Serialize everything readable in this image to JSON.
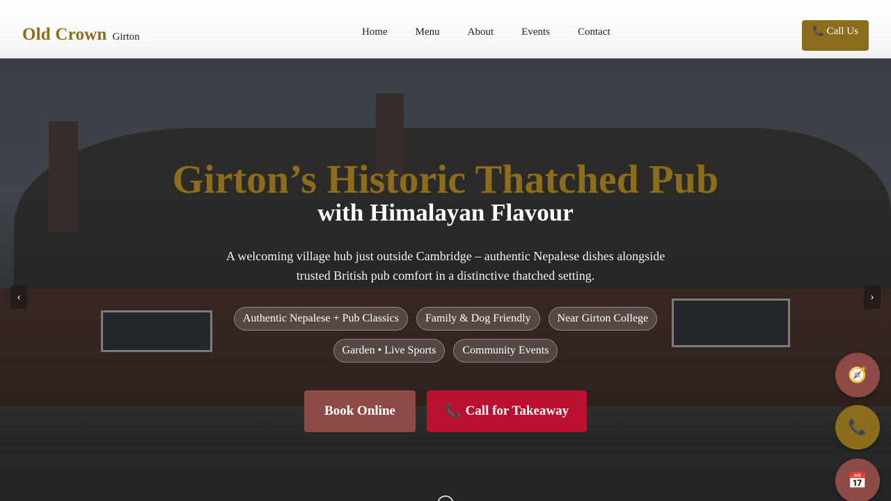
{
  "header": {
    "brand_name": "Old Crown",
    "brand_sub": "Girton",
    "nav": [
      "Home",
      "Menu",
      "About",
      "Events",
      "Contact"
    ],
    "call_label": "Call Us",
    "call_icon": "phone-icon"
  },
  "hero": {
    "title": "Girton’s Historic Thatched Pub",
    "subtitle": "with Himalayan Flavour",
    "description": "A welcoming village hub just outside Cambridge – authentic Nepalese dishes alongside trusted British pub comfort in a distinctive thatched setting.",
    "tags_row1": [
      "Authentic Nepalese + Pub Classics",
      "Family & Dog Friendly",
      "Near Girton College"
    ],
    "tags_row2": [
      "Garden • Live Sports",
      "Community Events"
    ],
    "book_label": "Book Online",
    "call_label": "Call for Takeaway",
    "prev_arrow": "‹",
    "next_arrow": "›"
  },
  "floating": {
    "icons": [
      "compass-icon",
      "phone-icon",
      "calendar-icon"
    ]
  },
  "colors": {
    "brand_gold": "#8b6d1c",
    "book_button": "#8e4a44",
    "call_button": "#b9102f"
  }
}
